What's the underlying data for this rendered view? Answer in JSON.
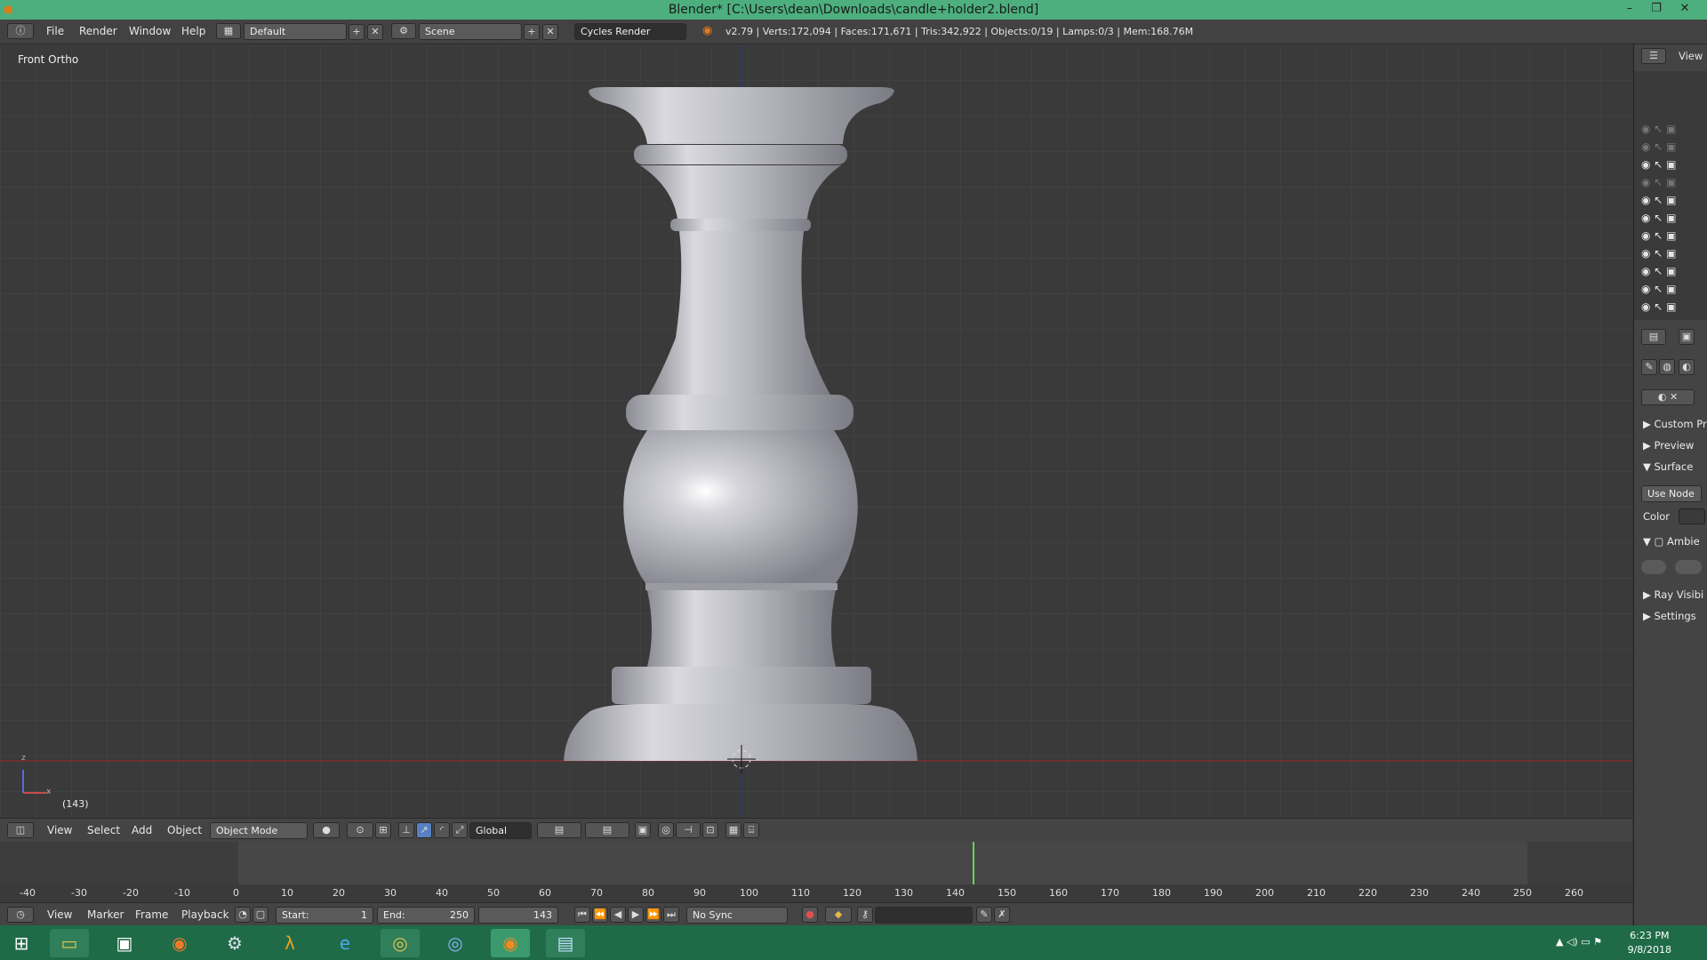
{
  "window": {
    "title": "Blender* [C:\\Users\\dean\\Downloads\\candle+holder2.blend]",
    "minimize": "–",
    "restore": "❐",
    "close": "✕"
  },
  "info_header": {
    "menus": [
      "File",
      "Render",
      "Window",
      "Help"
    ],
    "layout_name": "Default",
    "scene_name": "Scene",
    "render_engine": "Cycles Render",
    "stats": "v2.79 | Verts:172,094 | Faces:171,671 | Tris:342,922 | Objects:0/19 | Lamps:0/3 | Mem:168.76M"
  },
  "viewport": {
    "view_label": "Front Ortho",
    "frame_indicator": "(143)",
    "axis_labels": {
      "z": "z",
      "x": "x"
    }
  },
  "viewport_header": {
    "menus": [
      "View",
      "Select",
      "Add",
      "Object"
    ],
    "mode": "Object Mode",
    "orientation": "Global"
  },
  "timeline": {
    "ticks": [
      "-40",
      "-30",
      "-20",
      "-10",
      "0",
      "10",
      "20",
      "30",
      "40",
      "50",
      "60",
      "70",
      "80",
      "90",
      "100",
      "110",
      "120",
      "130",
      "140",
      "150",
      "160",
      "170",
      "180",
      "190",
      "200",
      "210",
      "220",
      "230",
      "240",
      "250",
      "260"
    ],
    "current_frame": 143,
    "menus": [
      "View",
      "Marker",
      "Frame",
      "Playback"
    ],
    "start_label": "Start:",
    "start_value": "1",
    "end_label": "End:",
    "end_value": "250",
    "frame_value": "143",
    "sync": "No Sync"
  },
  "right_panel": {
    "view_label": "View",
    "property_sections": [
      "Custom Pr",
      "Preview",
      "Surface",
      "Use Node",
      "Color",
      "Ambie",
      "Ray Visibi",
      "Settings"
    ]
  },
  "taskbar": {
    "time": "6:23 PM",
    "date": "9/8/2018"
  },
  "colors": {
    "title_bar": "#4caf7d",
    "taskbar": "#1f6b48",
    "viewport_bg": "#3a3a3a",
    "playhead": "#6ad25a",
    "x_axis": "#8a2a2a",
    "z_axis": "#2a3a8a"
  }
}
